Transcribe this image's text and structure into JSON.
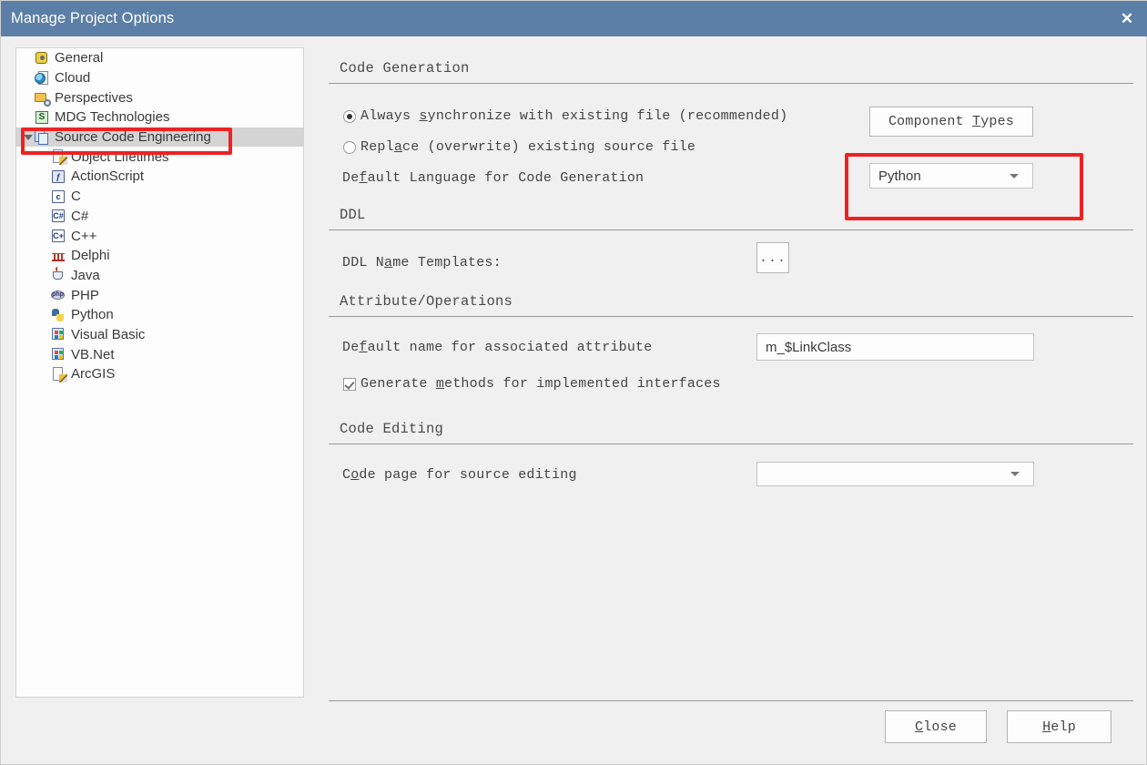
{
  "window": {
    "title": "Manage Project Options",
    "close_icon": "close-icon"
  },
  "sidebar": {
    "items": [
      {
        "label": "General",
        "icon": "gear-icon",
        "indent": 0,
        "expander": "none",
        "selected": false
      },
      {
        "label": "Cloud",
        "icon": "globe-icon",
        "indent": 0,
        "expander": "none",
        "selected": false
      },
      {
        "label": "Perspectives",
        "icon": "folder-search-icon",
        "indent": 0,
        "expander": "none",
        "selected": false
      },
      {
        "label": "MDG Technologies",
        "icon": "s-badge-icon",
        "indent": 0,
        "expander": "none",
        "selected": false
      },
      {
        "label": "Source Code Engineering",
        "icon": "stack-icon",
        "indent": 0,
        "expander": "expanded",
        "selected": true
      },
      {
        "label": "Object Lifetimes",
        "icon": "document-edit-icon",
        "indent": 1,
        "expander": "none",
        "selected": false
      },
      {
        "label": "ActionScript",
        "icon": "actionscript-icon",
        "indent": 1,
        "expander": "none",
        "selected": false
      },
      {
        "label": "C",
        "icon": "c-icon",
        "indent": 1,
        "expander": "none",
        "selected": false
      },
      {
        "label": "C#",
        "icon": "csharp-icon",
        "indent": 1,
        "expander": "none",
        "selected": false
      },
      {
        "label": "C++",
        "icon": "cplusplus-icon",
        "indent": 1,
        "expander": "none",
        "selected": false
      },
      {
        "label": "Delphi",
        "icon": "delphi-icon",
        "indent": 1,
        "expander": "none",
        "selected": false
      },
      {
        "label": "Java",
        "icon": "java-icon",
        "indent": 1,
        "expander": "none",
        "selected": false
      },
      {
        "label": "PHP",
        "icon": "php-icon",
        "indent": 1,
        "expander": "none",
        "selected": false
      },
      {
        "label": "Python",
        "icon": "python-icon",
        "indent": 1,
        "expander": "none",
        "selected": false
      },
      {
        "label": "Visual Basic",
        "icon": "visualbasic-icon",
        "indent": 1,
        "expander": "none",
        "selected": false
      },
      {
        "label": "VB.Net",
        "icon": "vbnet-icon",
        "indent": 1,
        "expander": "none",
        "selected": false
      },
      {
        "label": "ArcGIS",
        "icon": "arcgis-icon",
        "indent": 1,
        "expander": "none",
        "selected": false
      }
    ]
  },
  "main": {
    "code_generation": {
      "section_title": "Code Generation",
      "radio_sync": {
        "pre": "Always ",
        "acc": "s",
        "post": "ynchronize with existing file (recommended)",
        "selected": true
      },
      "radio_replace": {
        "pre": "Repl",
        "acc": "a",
        "post": "ce (overwrite) existing source file",
        "selected": false
      },
      "default_language_label": {
        "pre": "De",
        "acc": "f",
        "post": "ault Language for Code Generation"
      },
      "component_types_button": {
        "pre": "Component ",
        "acc": "T",
        "post": "ypes"
      },
      "language_combo_value": "Python"
    },
    "ddl": {
      "section_title": "DDL",
      "name_templates_label": {
        "pre": "DDL N",
        "acc": "a",
        "post": "me Templates:"
      },
      "browse_button_label": "..."
    },
    "attribute_operations": {
      "section_title": "Attribute/Operations",
      "default_name_label": {
        "pre": "De",
        "acc": "f",
        "post": "ault name for associated attribute"
      },
      "default_name_value": "m_$LinkClass",
      "generate_methods": {
        "pre": "Generate ",
        "acc": "m",
        "post": "ethods for implemented interfaces",
        "checked": true
      }
    },
    "code_editing": {
      "section_title": "Code Editing",
      "code_page_label": {
        "pre": "C",
        "acc": "o",
        "post": "de page for source editing"
      },
      "code_page_value": ""
    }
  },
  "footer": {
    "close_button": {
      "acc": "C",
      "post": "lose"
    },
    "help_button": {
      "acc": "H",
      "post": "elp"
    }
  },
  "annotations": {
    "highlight_color": "#ee2222",
    "boxes": [
      {
        "name": "sidebar-selection-highlight"
      },
      {
        "name": "language-combo-highlight"
      }
    ]
  }
}
